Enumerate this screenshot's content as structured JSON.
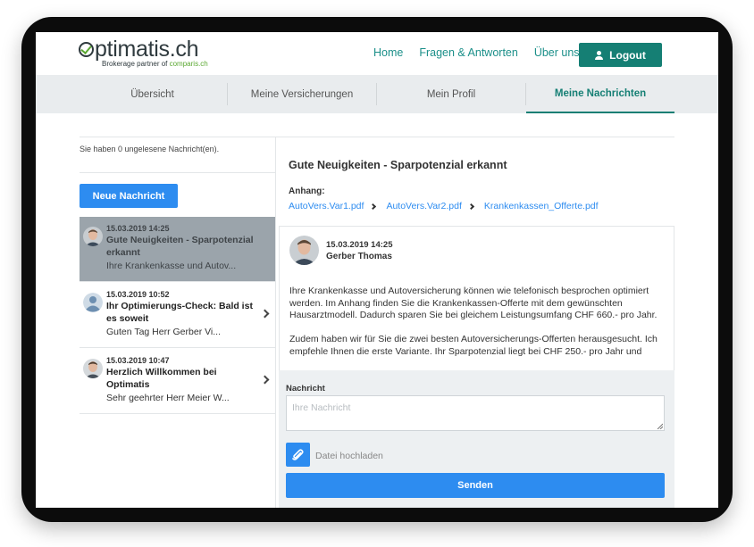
{
  "header": {
    "logo_text": "ptimatis.ch",
    "logo_sub": "Brokerage partner of",
    "logo_partner": "comparis.ch",
    "nav": [
      "Home",
      "Fragen & Antworten",
      "Über uns"
    ],
    "logout_label": "Logout"
  },
  "tabs": [
    {
      "label": "Übersicht",
      "active": false
    },
    {
      "label": "Meine Versicherungen",
      "active": false
    },
    {
      "label": "Mein Profil",
      "active": false
    },
    {
      "label": "Meine Nachrichten",
      "active": true
    }
  ],
  "inbox": {
    "unread_text": "Sie haben 0 ungelesene Nachricht(en).",
    "new_button": "Neue Nachricht",
    "messages": [
      {
        "date": "15.03.2019 14:25",
        "subject": "Gute Neuigkeiten - Sparpotenzial erkannt",
        "preview": "Ihre Krankenkasse und Autov...",
        "selected": true,
        "avatar": "person-photo"
      },
      {
        "date": "15.03.2019 10:52",
        "subject": "Ihr Optimierungs-Check: Bald ist es soweit",
        "preview": "Guten Tag Herr Gerber Vi...",
        "selected": false,
        "avatar": "default-avatar"
      },
      {
        "date": "15.03.2019 10:47",
        "subject": "Herzlich Willkommen bei Optimatis",
        "preview": "Sehr geehrter Herr Meier W...",
        "selected": false,
        "avatar": "person-photo"
      }
    ]
  },
  "detail": {
    "title": "Gute Neuigkeiten - Sparpotenzial erkannt",
    "attachments_label": "Anhang:",
    "attachments": [
      "AutoVers.Var1.pdf",
      "AutoVers.Var2.pdf",
      "Krankenkassen_Offerte.pdf"
    ],
    "date": "15.03.2019 14:25",
    "sender": "Gerber Thomas",
    "body": [
      "Ihre Krankenkasse und Autoversicherung können wie telefonisch besprochen optimiert werden. Im Anhang finden Sie die Krankenkassen-Offerte mit dem gewünschten Hausarztmodell. Dadurch sparen Sie bei gleichem Leistungsumfang CHF 660.- pro Jahr.",
      "Zudem haben wir für Sie die zwei besten Autoversicherungs-Offerten herausgesucht. Ich empfehle Ihnen die erste Variante. Ihr Sparpotenzial liegt bei CHF 250.- pro Jahr und"
    ]
  },
  "compose": {
    "label": "Nachricht",
    "placeholder": "Ihre Nachricht",
    "upload_label": "Datei hochladen",
    "send_label": "Senden"
  },
  "colors": {
    "brand_teal": "#157f74",
    "link_teal": "#1b8f89",
    "action_blue": "#2d8cf0",
    "selected_row": "#9ba4ab",
    "logo_green": "#5ba832"
  }
}
